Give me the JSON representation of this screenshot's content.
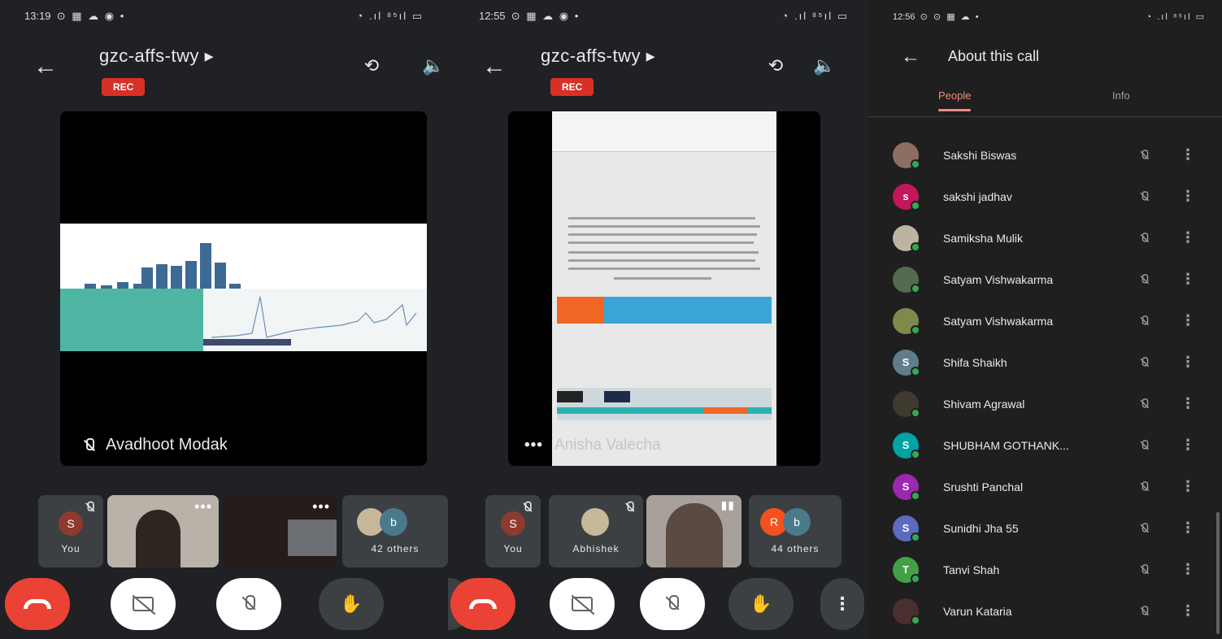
{
  "panel1": {
    "status": {
      "time": "13:19",
      "icons_left": "⊙ ▦ ☁ ◉ •",
      "icons_right": "◔ .ıl ⁸⁵ıl ▭"
    },
    "meeting_code": "gzc-affs-twy ▸",
    "rec": "REC",
    "presenter_name": "Avadhoot Modak",
    "tiles": [
      {
        "avatar": "S",
        "label": "You"
      },
      {
        "label": ""
      },
      {
        "label": ""
      },
      {
        "avatar2": "b",
        "label": "42 others"
      }
    ]
  },
  "panel2": {
    "status": {
      "time": "12:55",
      "icons_left": "⊙ ▦ ☁ ◉ •",
      "icons_right": "◔ .ıl ⁸⁵ıl ▭"
    },
    "meeting_code": "gzc-affs-twy ▸",
    "rec": "REC",
    "presenter_name": "Anisha Valecha",
    "tiles": [
      {
        "avatar": "S",
        "label": "You"
      },
      {
        "label": "Abhishek"
      },
      {
        "label": ""
      },
      {
        "avatar": "R",
        "avatar2": "b",
        "label": "44 others"
      }
    ]
  },
  "panel3": {
    "status": {
      "time": "12:56",
      "icons_left": "⊙ ⊙ ▦ ☁ •",
      "icons_right": "◔ .ıl ⁸⁵ıl ▭"
    },
    "title": "About this call",
    "tabs": {
      "people": "People",
      "info": "Info"
    },
    "people": [
      {
        "name": "Sakshi Biswas",
        "initial": "",
        "color": "#8d6e63"
      },
      {
        "name": "sakshi jadhav",
        "initial": "s",
        "color": "#c2185b"
      },
      {
        "name": "Samiksha Mulik",
        "initial": "",
        "color": "#bdb3a3"
      },
      {
        "name": "Satyam Vishwakarma",
        "initial": "",
        "color": "#556b4f"
      },
      {
        "name": "Satyam Vishwakarma",
        "initial": "",
        "color": "#7d8a4c"
      },
      {
        "name": "Shifa Shaikh",
        "initial": "S",
        "color": "#607d8b"
      },
      {
        "name": "Shivam Agrawal",
        "initial": "",
        "color": "#3e3a2e"
      },
      {
        "name": "SHUBHAM GOTHANK...",
        "initial": "S",
        "color": "#00a3a3"
      },
      {
        "name": "Srushti Panchal",
        "initial": "S",
        "color": "#9c27b0"
      },
      {
        "name": "Sunidhi Jha 55",
        "initial": "S",
        "color": "#5c6bc0"
      },
      {
        "name": "Tanvi Shah",
        "initial": "T",
        "color": "#43a047"
      },
      {
        "name": "Varun Kataria",
        "initial": "",
        "color": "#4a2f2f"
      }
    ]
  },
  "colors": {
    "end_call": "#ea4335",
    "rec": "#d93025",
    "tab_active": "#f28b82",
    "online": "#34a853"
  },
  "icons": {
    "back": "arrow-left-icon",
    "camera_flip": "camera-flip-icon",
    "speaker": "speaker-icon",
    "hand": "raise-hand-icon",
    "more": "more-vert-icon"
  }
}
